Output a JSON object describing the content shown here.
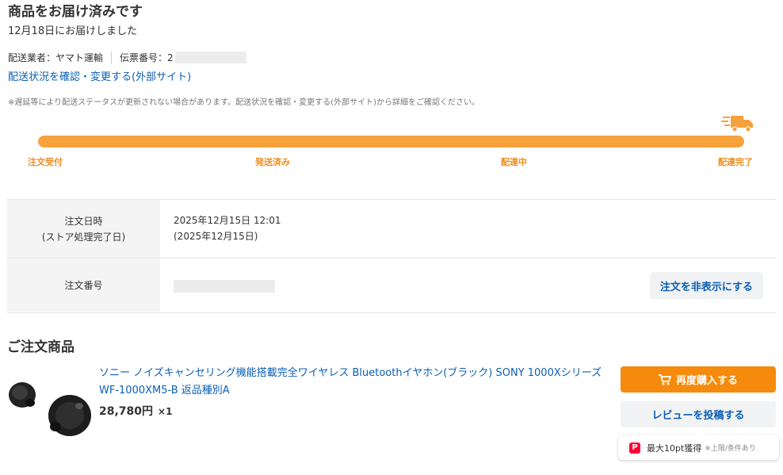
{
  "header": {
    "title": "商品をお届け済みです",
    "delivered_date": "12月18日にお届けしました"
  },
  "shipping": {
    "carrier_label": "配送業者：ヤマト運輸",
    "tracking_label": "伝票番号：2",
    "tracking_link": "配送状況を確認・変更する(外部サイト)",
    "notice": "※遅延等により配送ステータスが更新されない場合があります。配送状況を確認・変更する(外部サイト)から詳細をご確認ください。"
  },
  "progress": {
    "steps": [
      "注文受付",
      "発送済み",
      "配達中",
      "配達完了"
    ],
    "current_step": 4,
    "fill_fraction": 1.0,
    "color": "#f6a13b"
  },
  "order": {
    "date_label_1": "注文日時",
    "date_label_2": "(ストア処理完了日)",
    "date_value_1": "2025年12月15日 12:01",
    "date_value_2": "(2025年12月15日)",
    "number_label": "注文番号",
    "hide_button": "注文を非表示にする"
  },
  "products_section": {
    "title": "ご注文商品"
  },
  "product": {
    "name": "ソニー ノイズキャンセリング機能搭載完全ワイヤレス Bluetoothイヤホン(ブラック) SONY 1000Xシリーズ WF-1000XM5-B 返品種別A",
    "price": "28,780円",
    "quantity": "×1",
    "image": "black-earbuds"
  },
  "actions": {
    "rebuy": "再度購入する",
    "review": "レビューを投稿する",
    "points": "最大10pt獲得",
    "points_note": "※上限/条件あり"
  },
  "colors": {
    "accent_orange": "#f58a0c",
    "link_blue": "#0a5fb4",
    "step_orange": "#f08c1b"
  }
}
